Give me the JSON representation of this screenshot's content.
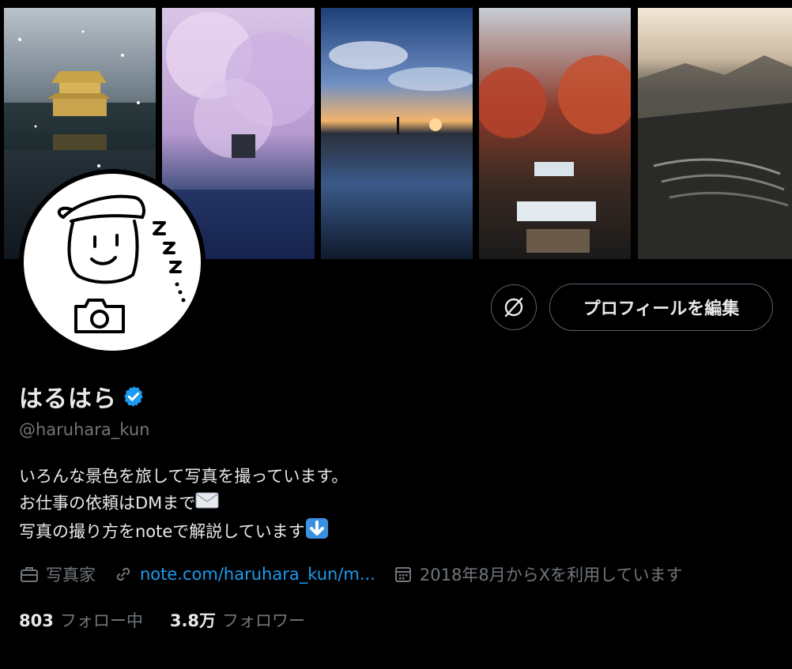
{
  "banner": {
    "photos": [
      {
        "name": "golden-pavilion-snow"
      },
      {
        "name": "cherry-blossom-night"
      },
      {
        "name": "sunset-reflection"
      },
      {
        "name": "autumn-waterfall"
      },
      {
        "name": "terraced-fields-mountains"
      }
    ]
  },
  "profile": {
    "display_name": "はるはら",
    "handle": "@haruhara_kun",
    "bio": [
      "いろんな景色を旅して写真を撮っています。",
      "お仕事の依頼はDMまで",
      "写真の撮り方をnoteで解説しています"
    ],
    "category": "写真家",
    "link": "note.com/haruhara_kun/m...",
    "joined": "2018年8月からXを利用しています",
    "following_count": "803",
    "following_label": "フォロー中",
    "followers_count": "3.8万",
    "followers_label": "フォロワー"
  },
  "actions": {
    "edit_profile_label": "プロフィールを編集"
  },
  "colors": {
    "accent": "#1d9bf0",
    "muted": "#71767b",
    "text": "#e7e9ea",
    "border": "#536471"
  }
}
